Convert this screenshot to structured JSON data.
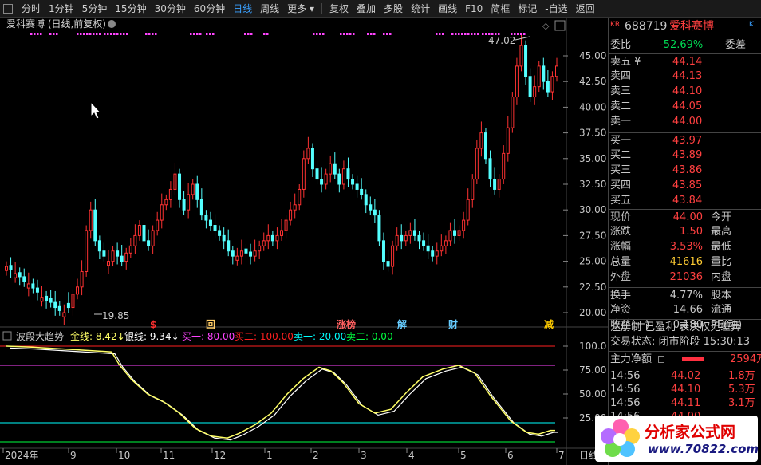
{
  "toolbar": {
    "left": [
      "分时",
      "1分钟",
      "5分钟",
      "15分钟",
      "30分钟",
      "60分钟",
      "日线",
      "周线",
      "更多 ▾"
    ],
    "active": "日线",
    "middle": [
      "复权",
      "叠加",
      "多股",
      "统计",
      "画线",
      "F10",
      "简框",
      "标记",
      "-自选",
      "返回"
    ]
  },
  "chart": {
    "title": "爱科赛博 (日线,前复权)",
    "y_ticks": [
      "45.00",
      "42.50",
      "40.00",
      "37.50",
      "35.00",
      "32.50",
      "30.00",
      "27.50",
      "25.00",
      "22.50",
      "20.00"
    ],
    "high_label": "47.02",
    "low_label": "19.85",
    "event_markers": [
      {
        "text": "$",
        "color": "#ff3030"
      },
      {
        "text": "回",
        "color": "#ffcc66"
      },
      {
        "text": "涨榜",
        "color": "#ff6060"
      },
      {
        "text": "解",
        "color": "#66ccff"
      },
      {
        "text": "财",
        "color": "#66ccff"
      },
      {
        "text": "减",
        "color": "#ffcc00"
      }
    ]
  },
  "indicator": {
    "name": "波段大趋势",
    "gold": "金线: 8.42↓",
    "silver": "银线: 9.34↓",
    "buy1": "买一: 80.00",
    "buy2": "买二: 100.00",
    "sell1": "卖一: 20.00",
    "sell2": "卖二: 0.00",
    "y_ticks": [
      "100.0",
      "75.00",
      "50.00",
      "25.00"
    ]
  },
  "x_axis": [
    "2024年",
    "9",
    "10",
    "11",
    "12",
    "1",
    "2",
    "3",
    "4",
    "5",
    "6",
    "7"
  ],
  "x_axis_right": "日线",
  "colors": {
    "up": "#ff3232",
    "down": "#54ffff",
    "gold": "#ffff66",
    "silver": "#ffffff",
    "buy1": "#ff44ff",
    "buy2": "#ff2020",
    "sell1": "#00ffff",
    "sell2": "#00ff40"
  },
  "sidebar": {
    "code": "688719",
    "name": "爱科赛博",
    "kr": "KR",
    "webi_label": "委比",
    "webi_value": "-52.69%",
    "weicha_label": "委差",
    "asks": [
      {
        "label": "卖五",
        "flag": "¥",
        "price": "44.14"
      },
      {
        "label": "卖四",
        "flag": "",
        "price": "44.13"
      },
      {
        "label": "卖三",
        "flag": "",
        "price": "44.10"
      },
      {
        "label": "卖二",
        "flag": "",
        "price": "44.05"
      },
      {
        "label": "卖一",
        "flag": "",
        "price": "44.00"
      }
    ],
    "bids": [
      {
        "label": "买一",
        "price": "43.97"
      },
      {
        "label": "买二",
        "price": "43.89"
      },
      {
        "label": "买三",
        "price": "43.86"
      },
      {
        "label": "买四",
        "price": "43.85"
      },
      {
        "label": "买五",
        "price": "43.84"
      }
    ],
    "stats": [
      {
        "l": "现价",
        "v": "44.00",
        "vc": "#ff4040",
        "r": "今开"
      },
      {
        "l": "涨跌",
        "v": "1.50",
        "vc": "#ff4040",
        "r": "最高"
      },
      {
        "l": "涨幅",
        "v": "3.53%",
        "vc": "#ff4040",
        "r": "最低"
      },
      {
        "l": "总量",
        "v": "41616",
        "vc": "#ffcc33",
        "r": "量比"
      },
      {
        "l": "外盘",
        "v": "21036",
        "vc": "#ff4040",
        "r": "内盘"
      }
    ],
    "stats2": [
      {
        "l": "换手",
        "v": "4.77%",
        "r": "股本"
      },
      {
        "l": "净资",
        "v": "14.66",
        "r": "流通"
      },
      {
        "l": "收益(一)",
        "v": "-0.180",
        "r": "PE(动)"
      }
    ],
    "tags": "注册制 已盈利 表决权无差异",
    "trade_status": "交易状态: 闭市阶段 15:30:13",
    "main_flow_label": "主力净额",
    "main_flow_value": "2594万",
    "ticks": [
      {
        "t": "14:56",
        "p": "44.02",
        "v": "1.8万"
      },
      {
        "t": "14:56",
        "p": "44.10",
        "v": "5.3万"
      },
      {
        "t": "14:56",
        "p": "44.11",
        "v": "3.1万"
      },
      {
        "t": "14:56",
        "p": "44.00",
        "v": ""
      }
    ]
  },
  "logo": {
    "title": "分析家公式网",
    "url": "www.70822.com"
  }
}
